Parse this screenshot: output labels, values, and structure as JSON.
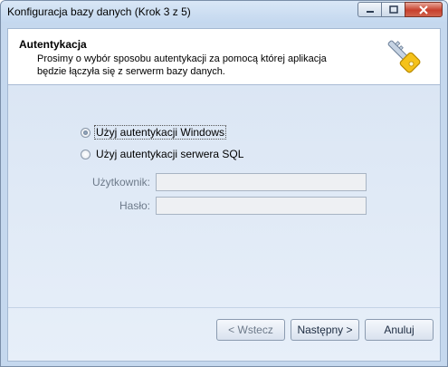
{
  "window": {
    "title": "Konfiguracja bazy danych (Krok 3 z 5)",
    "controls": {
      "minimize_icon": "minimize-icon",
      "maximize_icon": "maximize-icon",
      "close_icon": "close-icon"
    }
  },
  "header": {
    "title": "Autentykacja",
    "description": "Prosimy o wybór sposobu autentykacji za pomocą której aplikacja będzie łączyła się z serwerm bazy danych.",
    "icon": "key-icon"
  },
  "auth": {
    "options": [
      {
        "label": "Użyj autentykacji Windows",
        "selected": true
      },
      {
        "label": "Użyj autentykacji serwera SQL",
        "selected": false
      }
    ],
    "user_label": "Użytkownik:",
    "user_value": "",
    "password_label": "Hasło:",
    "password_value": ""
  },
  "buttons": {
    "back": "< Wstecz",
    "next": "Następny >",
    "cancel": "Anuluj"
  },
  "colors": {
    "accent": "#f0b400",
    "close_button": "#c7402d",
    "frame": "#c5d8ee"
  }
}
